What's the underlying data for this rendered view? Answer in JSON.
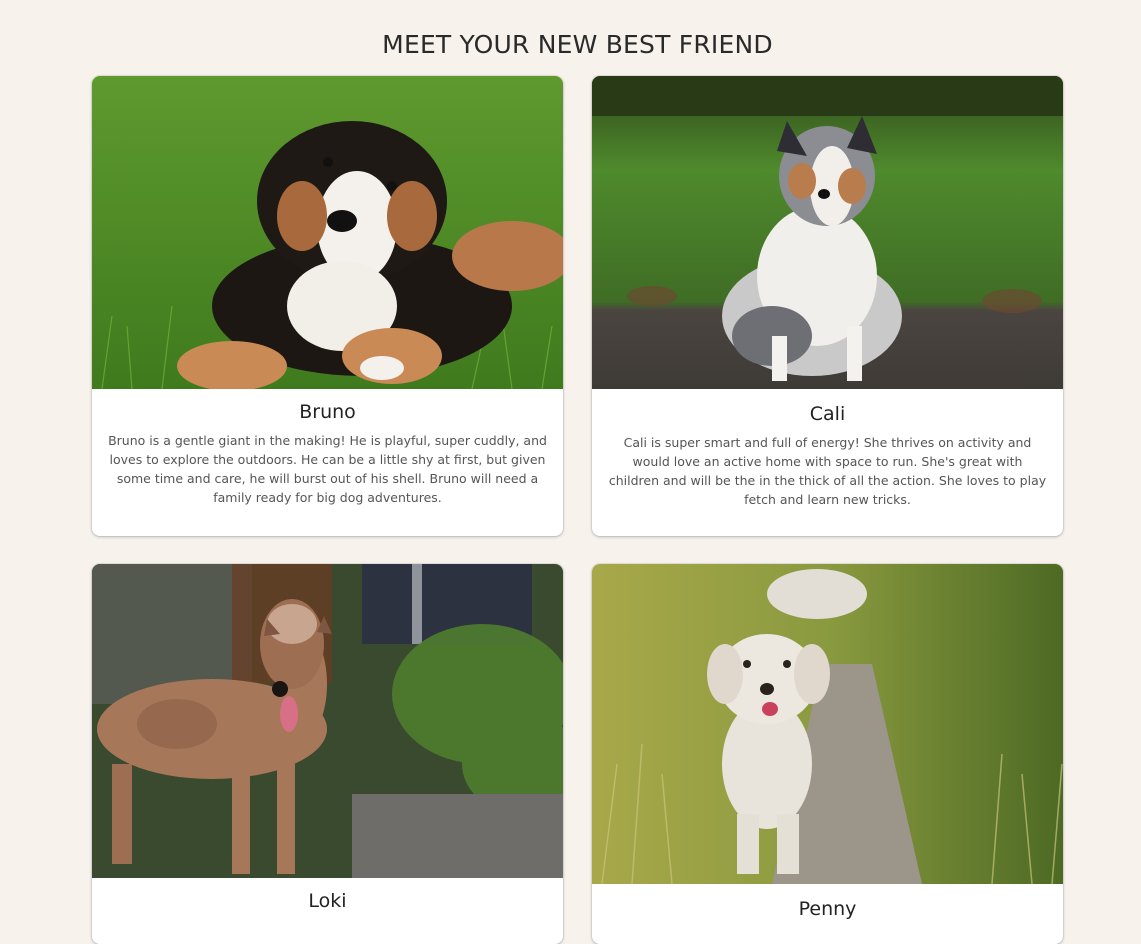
{
  "page": {
    "title": "MEET YOUR NEW BEST FRIEND"
  },
  "dogs": [
    {
      "name": "Bruno",
      "description": "Bruno is a gentle giant in the making! He is playful, super cuddly, and loves to explore the outdoors. He can be a little shy at first, but given some time and care, he will burst out of his shell. Bruno will need a family ready for big dog adventures."
    },
    {
      "name": "Cali",
      "description": "Cali is super smart and full of energy! She thrives on activity and would love an active home with space to run. She's great with children and will be the in the thick of all the action. She loves to play fetch and learn new tricks."
    },
    {
      "name": "Loki",
      "description": ""
    },
    {
      "name": "Penny",
      "description": ""
    }
  ],
  "colors": {
    "background": "#f7f2ec",
    "card": "#ffffff",
    "text": "#222222",
    "muted_text": "#555555"
  }
}
